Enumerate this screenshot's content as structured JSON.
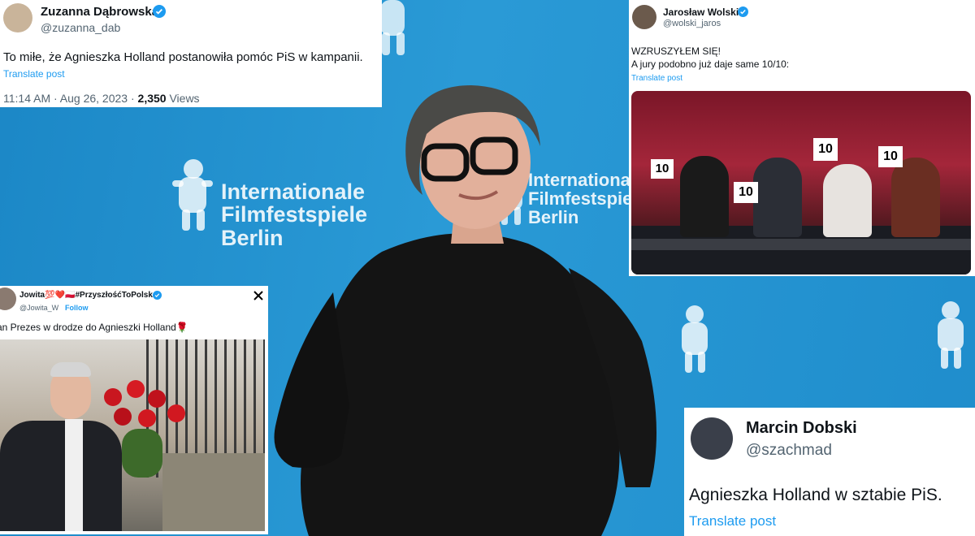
{
  "background": {
    "festival_lines": [
      "Internationale",
      "Filmfestspiele",
      "Berlin"
    ],
    "logo_script": "Berlinale",
    "accent": "#1d8fce"
  },
  "tweet1": {
    "name": "Zuzanna Dąbrowska",
    "handle": "@zuzanna_dab",
    "text": "To miłe, że Agnieszka Holland postanowiła pomóc PiS w kampanii.",
    "translate": "Translate post",
    "time": "11:14 AM · Aug 26, 2023 · ",
    "views_count": "2,350",
    "views_label": " Views"
  },
  "tweet2": {
    "name": "Jarosław Wolski",
    "handle": "@wolski_jaros",
    "line1": "WZRUSZYŁEM SIĘ!",
    "line2": "A jury podobno już daje same 10/10:",
    "translate": "Translate post",
    "score_cards": [
      "10",
      "10",
      "10",
      "10"
    ]
  },
  "tweet3": {
    "name": "Jowita💯❤️🇵🇱#PrzyszłośćToPolska",
    "handle": "@Jowita_W",
    "follow": "Follow",
    "text": "an Prezes w drodze do Agnieszki Holland🌹",
    "x_icon": "x-logo-icon"
  },
  "tweet4": {
    "name": "Marcin Dobski",
    "handle": "@szachmad",
    "text": "Agnieszka Holland w sztabie PiS.",
    "translate": "Translate post"
  }
}
